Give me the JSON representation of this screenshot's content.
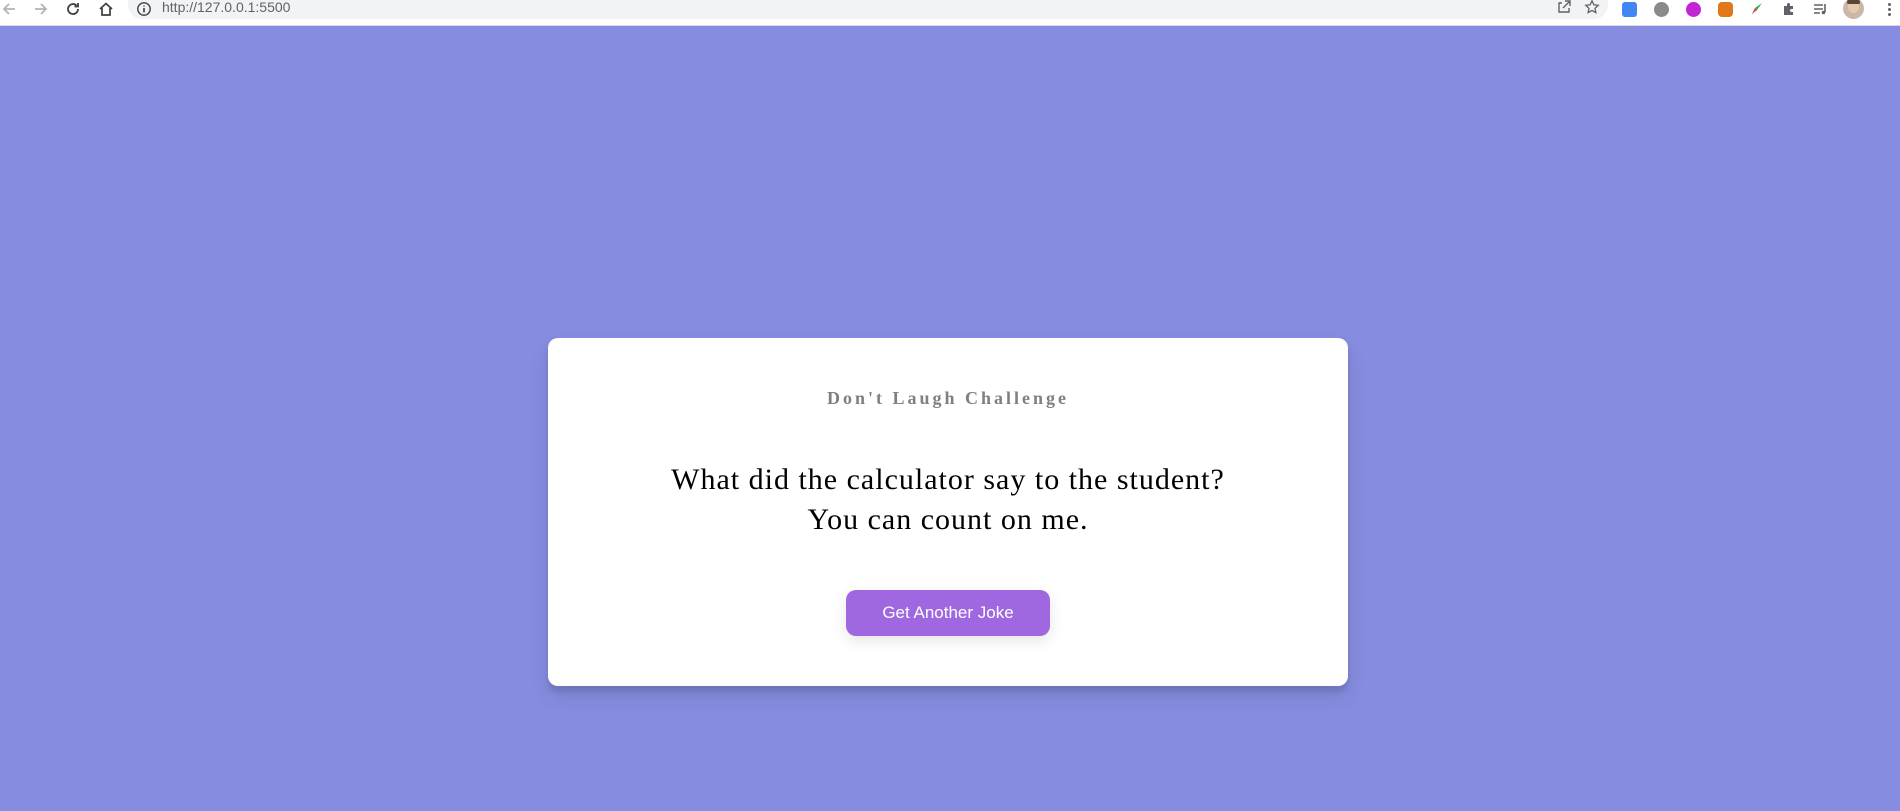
{
  "browser": {
    "url": "http://127.0.0.1:5500"
  },
  "colors": {
    "page_background": "#868de0",
    "button": "#9f68e0",
    "heading_text": "#808080"
  },
  "card": {
    "heading": "Don't Laugh Challenge",
    "joke_lines": [
      "What did the calculator say to the student?",
      "You can count on me."
    ],
    "button_label": "Get Another Joke"
  },
  "icons": {
    "nav": [
      "back-arrow-icon",
      "forward-arrow-icon",
      "reload-icon",
      "home-icon"
    ],
    "omnibox": [
      "site-info-icon",
      "share-icon",
      "bookmark-star-icon"
    ],
    "extensions": [
      "google-translate-icon",
      "extension-globe-icon",
      "extension-purple-icon",
      "metamask-fox-icon",
      "extension-rocket-icon",
      "extensions-puzzle-icon",
      "reading-list-icon"
    ]
  }
}
